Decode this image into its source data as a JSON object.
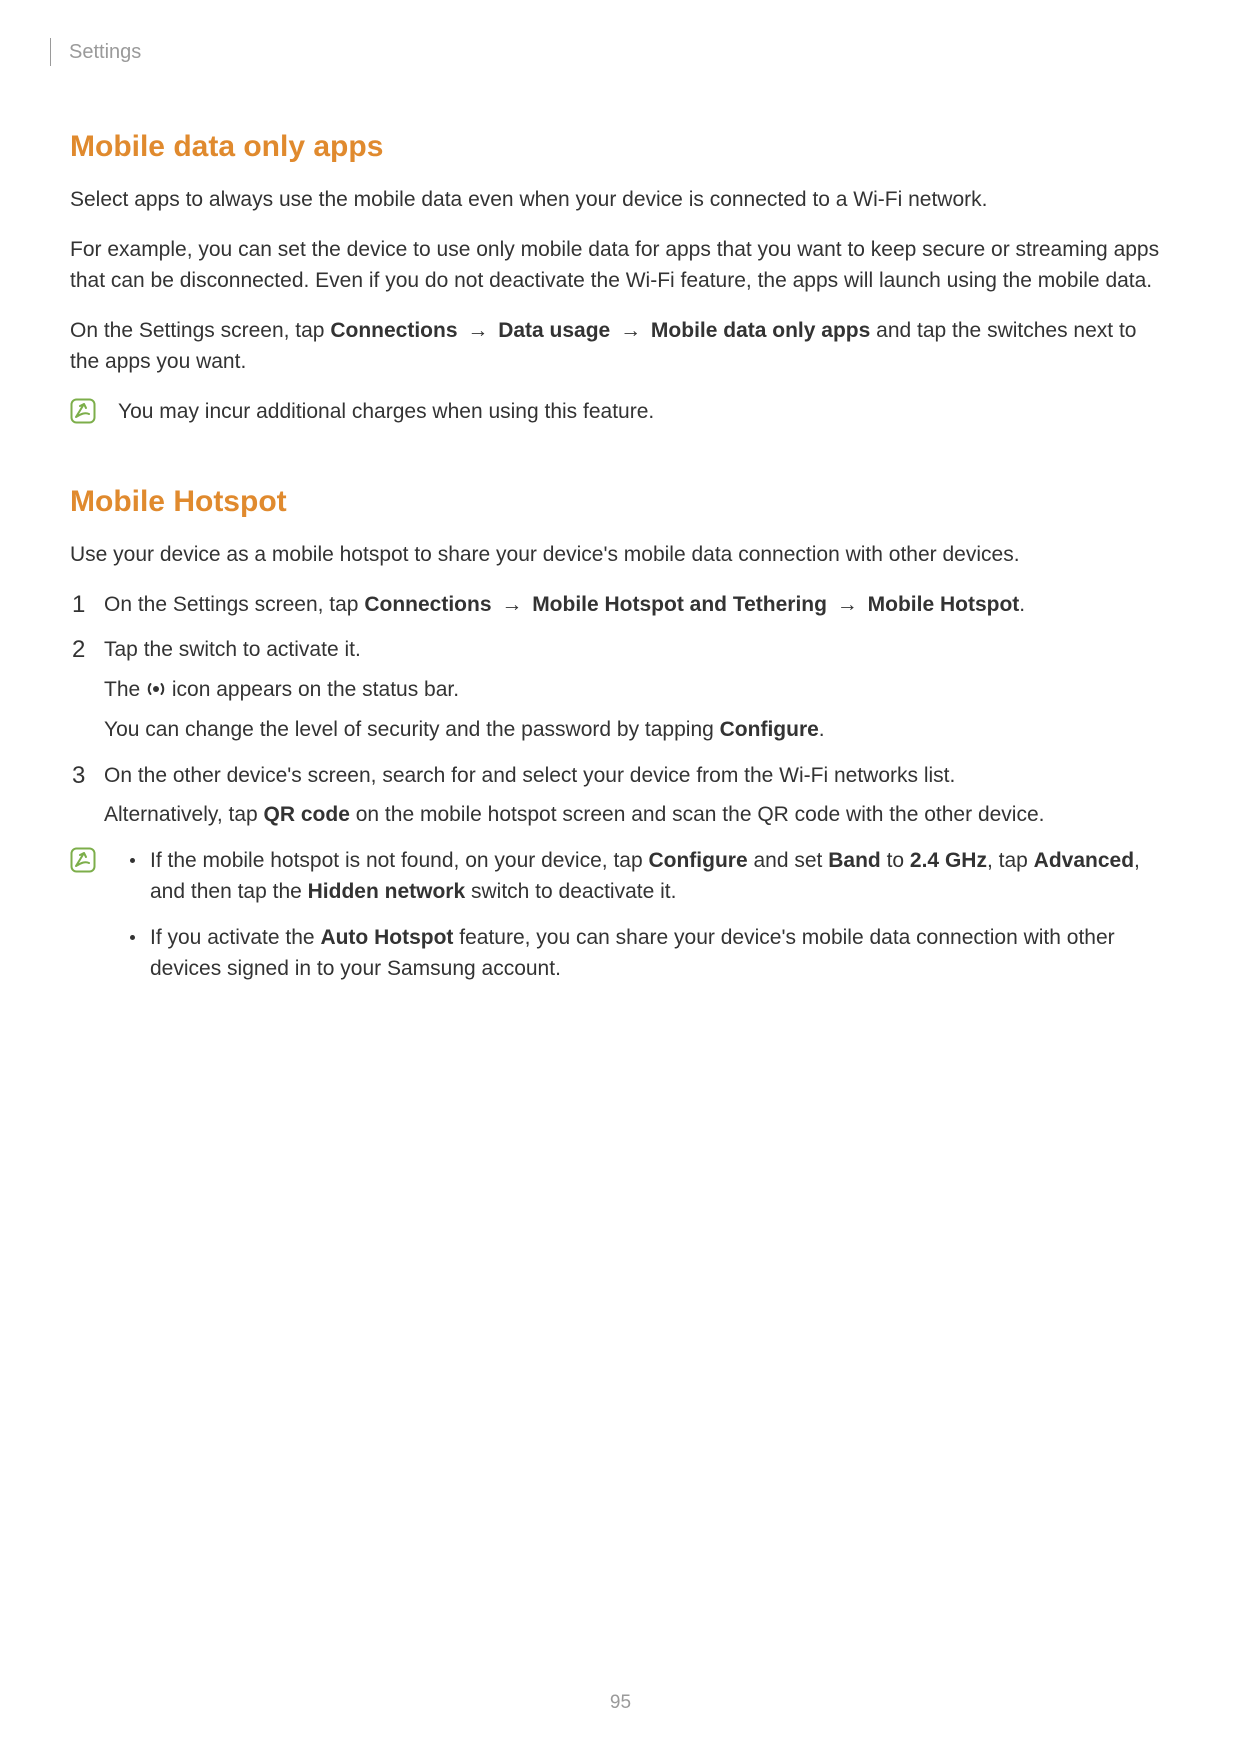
{
  "header": {
    "section": "Settings"
  },
  "page_number": "95",
  "bullet_glyph": "•",
  "section1": {
    "heading": "Mobile data only apps",
    "p1": "Select apps to always use the mobile data even when your device is connected to a Wi-Fi network.",
    "p2": "For example, you can set the device to use only mobile data for apps that you want to keep secure or streaming apps that can be disconnected. Even if you do not deactivate the Wi-Fi feature, the apps will launch using the mobile data.",
    "p3": {
      "pre": "On the Settings screen, tap ",
      "path1": "Connections",
      "arrow": "→",
      "path2": "Data usage",
      "path3": "Mobile data only apps",
      "post": " and tap the switches next to the apps you want."
    },
    "note": "You may incur additional charges when using this feature."
  },
  "section2": {
    "heading": "Mobile Hotspot",
    "p1": "Use your device as a mobile hotspot to share your device's mobile data connection with other devices.",
    "steps": [
      {
        "pre": "On the Settings screen, tap ",
        "path1": "Connections",
        "arrow": "→",
        "path2": "Mobile Hotspot and Tethering",
        "path3": "Mobile Hotspot",
        "post": "."
      },
      {
        "line1": "Tap the switch to activate it.",
        "line2_pre": "The ",
        "line2_post": " icon appears on the status bar.",
        "line3_pre": "You can change the level of security and the password by tapping ",
        "line3_bold": "Configure",
        "line3_post": "."
      },
      {
        "line1": "On the other device's screen, search for and select your device from the Wi-Fi networks list.",
        "line2_pre": "Alternatively, tap ",
        "line2_bold": "QR code",
        "line2_post": " on the mobile hotspot screen and scan the QR code with the other device."
      }
    ],
    "tips": [
      {
        "t1": "If the mobile hotspot is not found, on your device, tap ",
        "b1": "Configure",
        "t2": " and set ",
        "b2": "Band",
        "t3": " to ",
        "b3": "2.4 GHz",
        "t4": ", tap ",
        "b4": "Advanced",
        "t5": ", and then tap the ",
        "b5": "Hidden network",
        "t6": " switch to deactivate it."
      },
      {
        "t1": "If you activate the ",
        "b1": "Auto Hotspot",
        "t2": " feature, you can share your device's mobile data connection with other devices signed in to your Samsung account."
      }
    ]
  }
}
